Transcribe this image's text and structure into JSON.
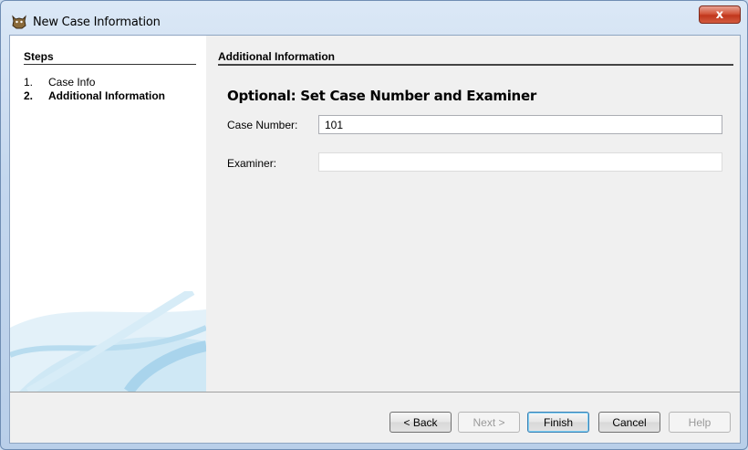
{
  "window": {
    "title": "New Case Information",
    "close_label": "x"
  },
  "steps": {
    "header": "Steps",
    "items": [
      {
        "num": "1.",
        "label": "Case Info"
      },
      {
        "num": "2.",
        "label": "Additional Information"
      }
    ],
    "current_index": 2
  },
  "content": {
    "header": "Additional Information",
    "title": "Optional: Set Case Number and Examiner",
    "case_number_label": "Case Number:",
    "case_number_value": "101",
    "examiner_label": "Examiner:",
    "examiner_value": ""
  },
  "buttons": {
    "back": "< Back",
    "next": "Next >",
    "finish": "Finish",
    "cancel": "Cancel",
    "help": "Help"
  },
  "colors": {
    "title_bar": "#c4d7ee",
    "close_button": "#c1361c",
    "panel": "#f0f0f0",
    "default_button_border": "#3c7fb1"
  },
  "icons": {
    "app": "app-icon",
    "close": "close-icon",
    "decoration": "swoosh-decoration"
  }
}
